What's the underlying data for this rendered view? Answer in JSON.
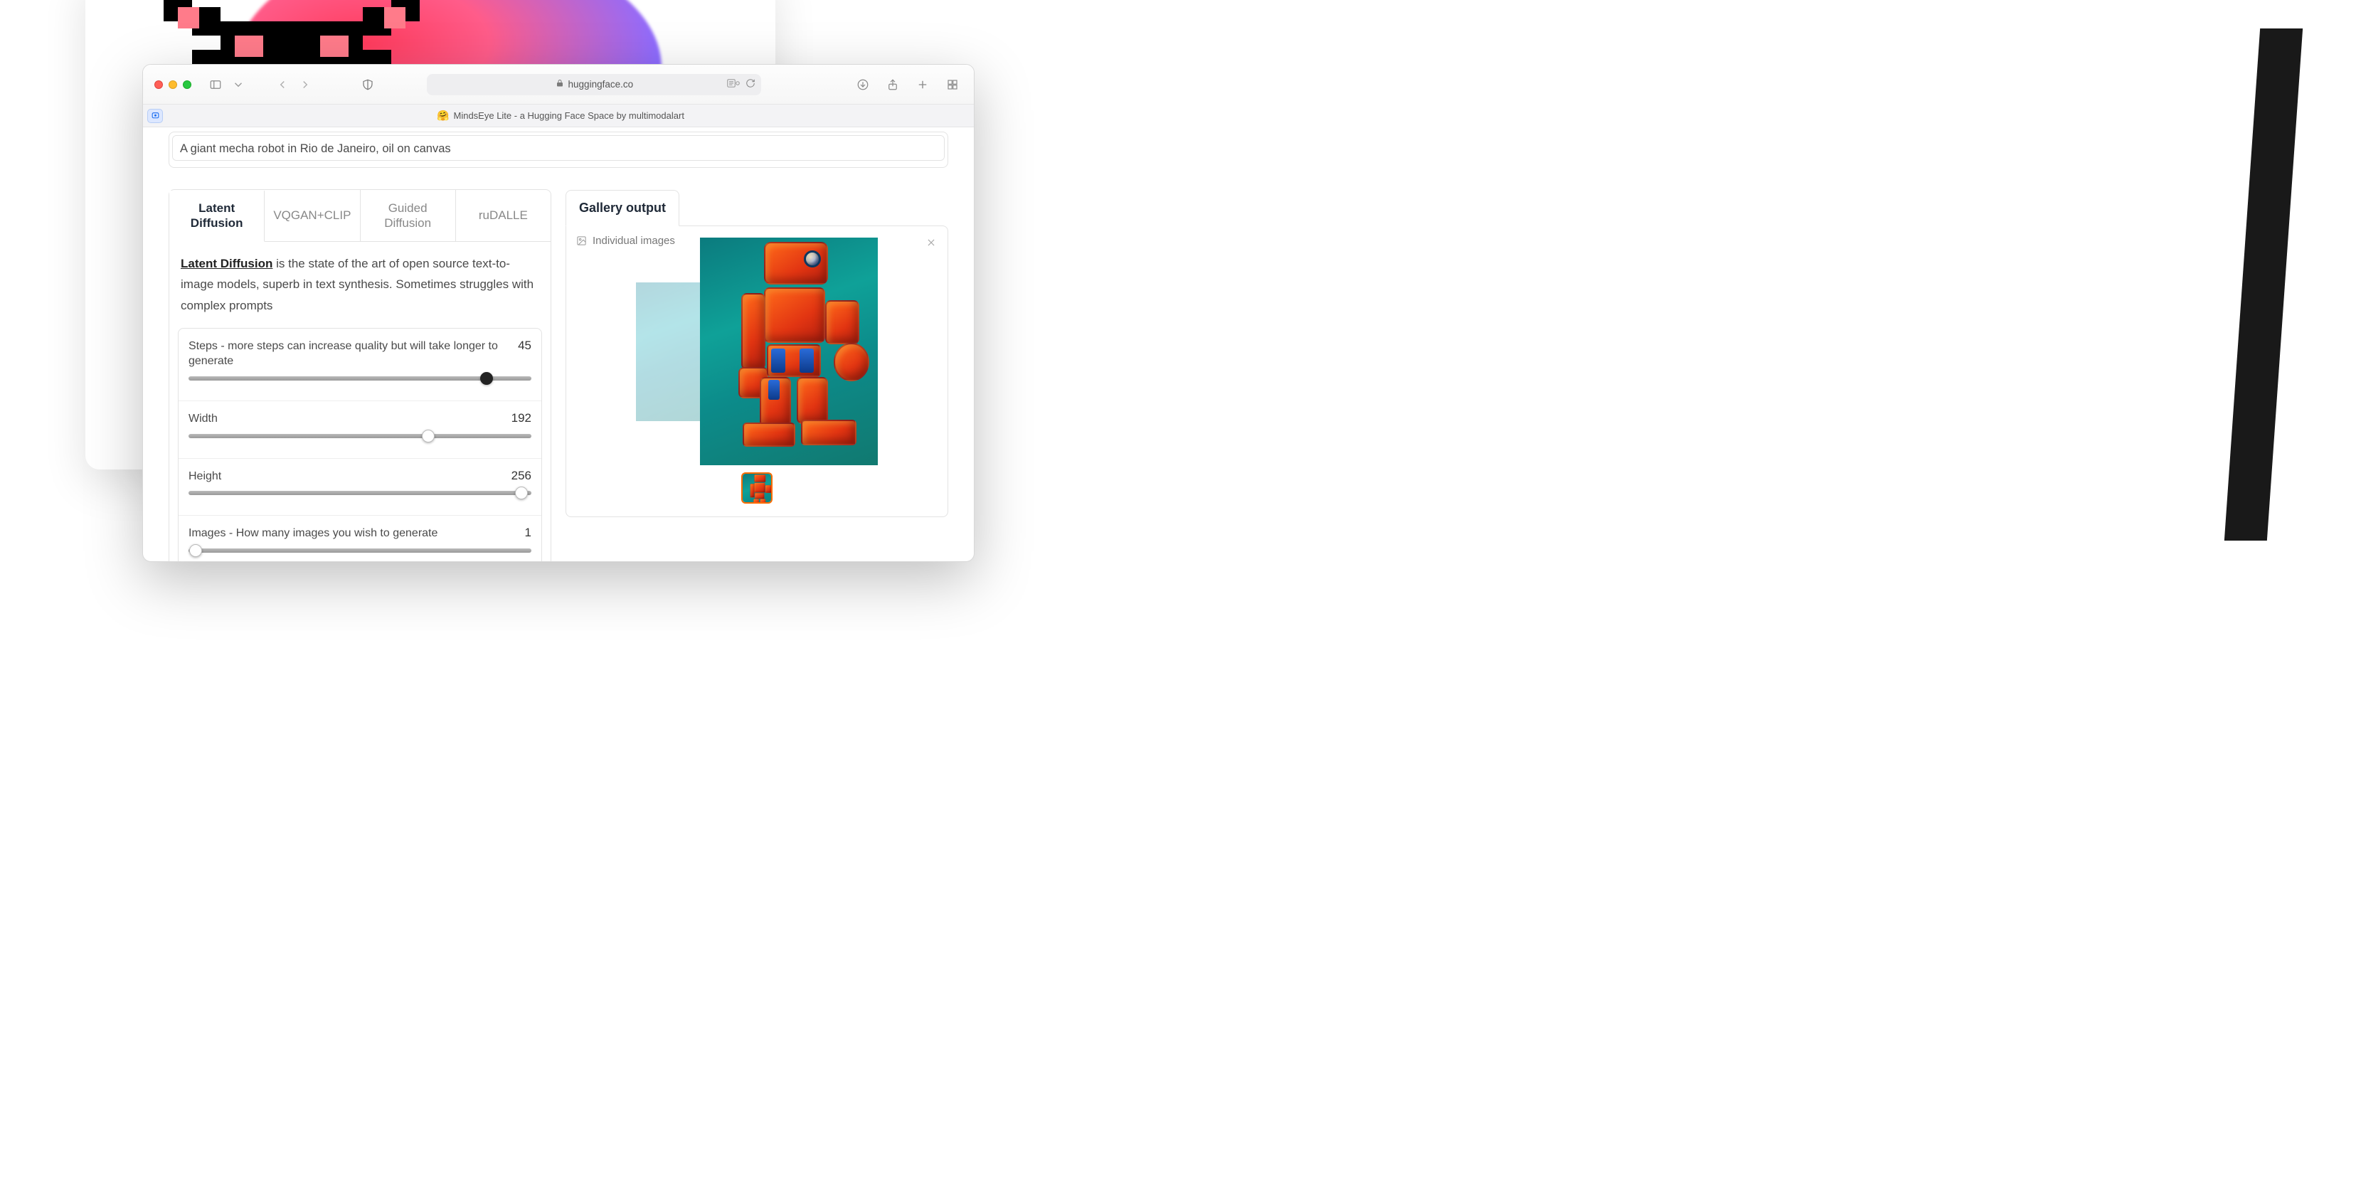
{
  "browser": {
    "lock_label": "Secure",
    "domain": "huggingface.co",
    "tab_emoji": "🤗",
    "tab_title": "MindsEye Lite - a Hugging Face Space by multimodalart"
  },
  "prompt": {
    "value": "A giant mecha robot in Rio de Janeiro, oil on canvas"
  },
  "tabs": [
    {
      "id": "latent",
      "label": "Latent Diffusion",
      "active": true
    },
    {
      "id": "vqgan",
      "label": "VQGAN+CLIP",
      "active": false
    },
    {
      "id": "guided",
      "label": "Guided Diffusion",
      "active": false
    },
    {
      "id": "rudalle",
      "label": "ruDALLE",
      "active": false
    }
  ],
  "description": {
    "link_text": "Latent Diffusion",
    "rest": " is the state of the art of open source text-to-image models, superb in text synthesis. Sometimes struggles with complex prompts"
  },
  "sliders": {
    "steps": {
      "label": "Steps - more steps can increase quality but will take longer to generate",
      "value": "45",
      "percent": 87
    },
    "width": {
      "label": "Width",
      "value": "192",
      "percent": 70
    },
    "height": {
      "label": "Height",
      "value": "256",
      "percent": 97
    },
    "images": {
      "label": "Images - How many images you wish to generate",
      "value": "1",
      "percent": 2
    }
  },
  "gallery": {
    "tab_label": "Gallery output",
    "individual_label": "Individual images"
  }
}
